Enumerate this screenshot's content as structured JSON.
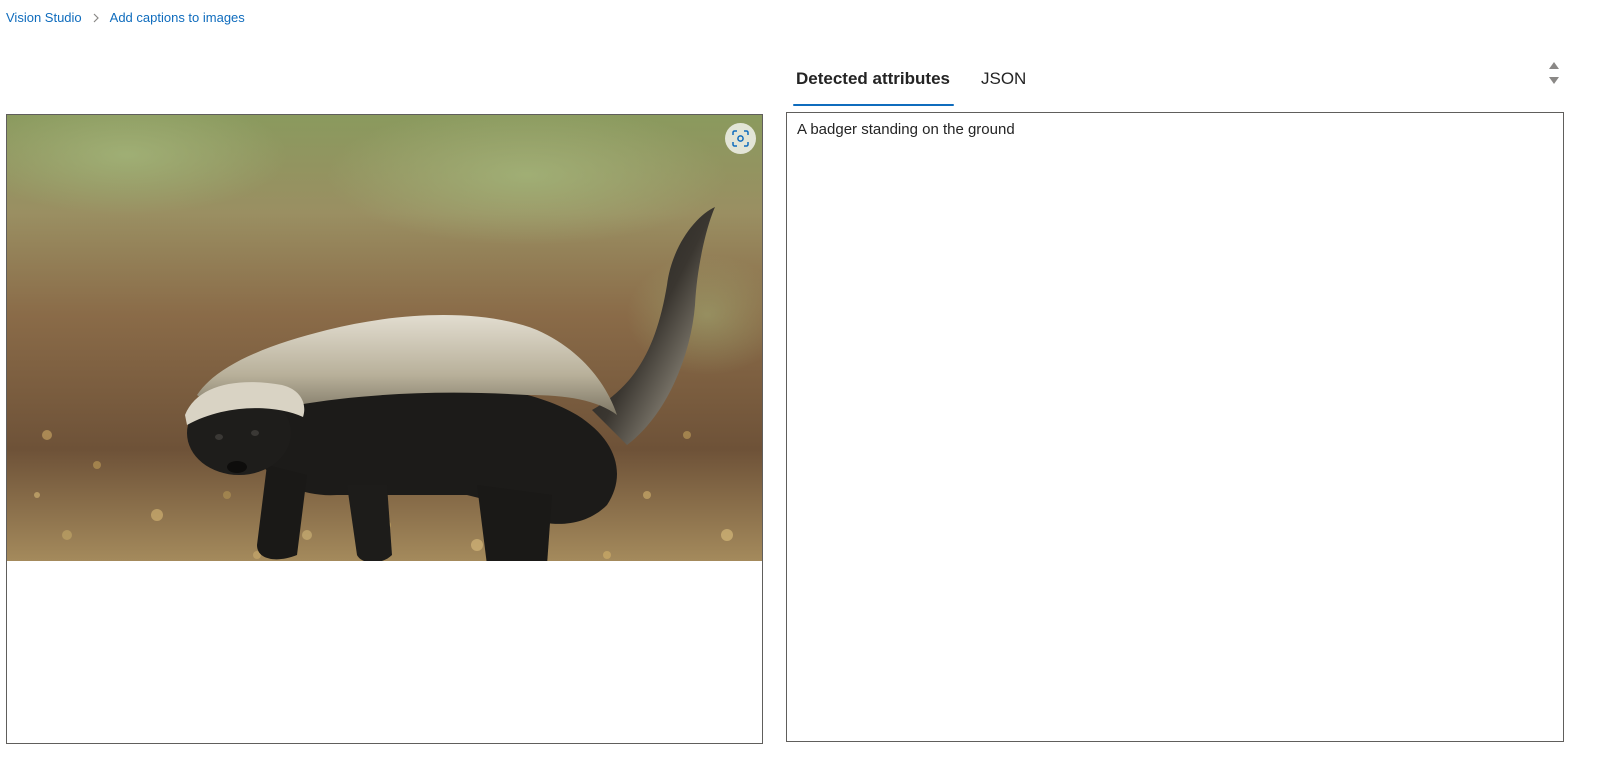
{
  "breadcrumb": {
    "root": "Vision Studio",
    "current": "Add captions to images",
    "separator_icon": "chevron-right-icon"
  },
  "image_panel": {
    "focus_icon": "focus-frame-icon"
  },
  "tabs": [
    {
      "label": "Detected attributes",
      "active": true
    },
    {
      "label": "JSON",
      "active": false
    }
  ],
  "result": {
    "caption": "A badger standing on the ground"
  },
  "colors": {
    "link": "#0f6cbd",
    "tab_underline": "#0f6cbd",
    "border": "#605e5c"
  }
}
